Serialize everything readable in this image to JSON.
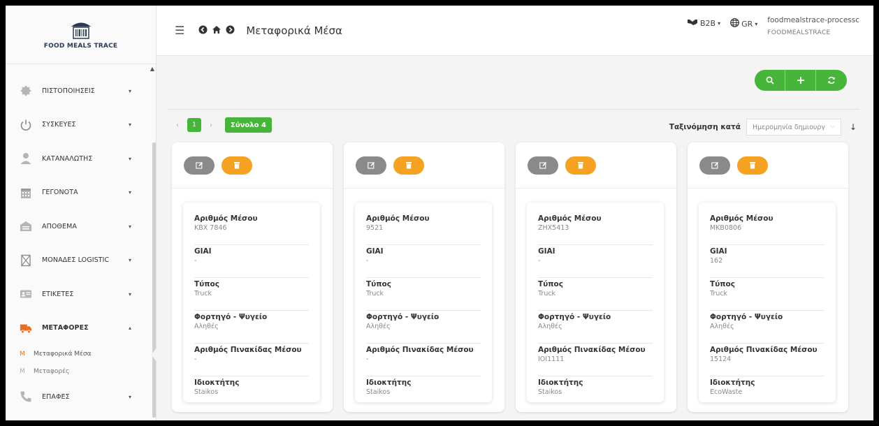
{
  "logo": {
    "text": "FOOD MEALS TRACE"
  },
  "sidebar": {
    "items": [
      {
        "label": "ΠΙΣΤΟΠΟΙΗΣΕΙΣ",
        "icon": "certificate-icon"
      },
      {
        "label": "ΣΥΣΚΕΥΕΣ",
        "icon": "power-icon"
      },
      {
        "label": "ΚΑΤΑΝΑΛΩΤΗΣ",
        "icon": "user-icon"
      },
      {
        "label": "ΓΕΓΟΝΟΤΑ",
        "icon": "calendar-icon"
      },
      {
        "label": "ΑΠΟΘΕΜΑ",
        "icon": "warehouse-icon"
      },
      {
        "label": "ΜΟΝΑΔΕΣ LOGISTIC",
        "icon": "box-icon"
      },
      {
        "label": "ΕΤΙΚΕΤΕΣ",
        "icon": "id-card-icon"
      },
      {
        "label": "ΜΕΤΑΦΟΡΕΣ",
        "icon": "truck-icon"
      },
      {
        "label": "ΕΠΑΦΕΣ",
        "icon": "phone-icon"
      }
    ],
    "subitems": [
      {
        "prefix": "M",
        "label": "Μεταφορικά Μέσα"
      },
      {
        "prefix": "M",
        "label": "Μεταφορές"
      }
    ]
  },
  "header": {
    "title": "Μεταφορικά Μέσα",
    "b2b": "B2B",
    "lang": "GR",
    "user": "foodmealstrace-processc",
    "org": "FOODMEALSTRACE"
  },
  "pager": {
    "page": "1",
    "total": "Σύνολο 4"
  },
  "sort": {
    "label": "Ταξινόμηση κατά",
    "value": "Ημερομηνία δημιουργ"
  },
  "cards": [
    {
      "fields": [
        {
          "label": "Αριθμός Μέσου",
          "value": "KBX 7846"
        },
        {
          "label": "GIAI",
          "value": "-"
        },
        {
          "label": "Τύπος",
          "value": "Truck"
        },
        {
          "label": "Φορτηγό - Ψυγείο",
          "value": "Αληθές"
        },
        {
          "label": "Αριθμός Πινακίδας Μέσου",
          "value": "-"
        },
        {
          "label": "Ιδιοκτήτης",
          "value": "Staikos"
        }
      ]
    },
    {
      "fields": [
        {
          "label": "Αριθμός Μέσου",
          "value": "9521"
        },
        {
          "label": "GIAI",
          "value": "-"
        },
        {
          "label": "Τύπος",
          "value": "Truck"
        },
        {
          "label": "Φορτηγό - Ψυγείο",
          "value": "Αληθές"
        },
        {
          "label": "Αριθμός Πινακίδας Μέσου",
          "value": "-"
        },
        {
          "label": "Ιδιοκτήτης",
          "value": "Staikos"
        }
      ]
    },
    {
      "fields": [
        {
          "label": "Αριθμός Μέσου",
          "value": "ZHX5413"
        },
        {
          "label": "GIAI",
          "value": "-"
        },
        {
          "label": "Τύπος",
          "value": "Truck"
        },
        {
          "label": "Φορτηγό - Ψυγείο",
          "value": "Αληθές"
        },
        {
          "label": "Αριθμός Πινακίδας Μέσου",
          "value": "IOI1111"
        },
        {
          "label": "Ιδιοκτήτης",
          "value": "Staikos"
        }
      ]
    },
    {
      "fields": [
        {
          "label": "Αριθμός Μέσου",
          "value": "MKB0806"
        },
        {
          "label": "GIAI",
          "value": "162"
        },
        {
          "label": "Τύπος",
          "value": "Truck"
        },
        {
          "label": "Φορτηγό - Ψυγείο",
          "value": "Αληθές"
        },
        {
          "label": "Αριθμός Πινακίδας Μέσου",
          "value": "15124"
        },
        {
          "label": "Ιδιοκτήτης",
          "value": "EcoWaste"
        }
      ]
    }
  ],
  "colors": {
    "accent": "#47b43a",
    "delete": "#f5a121",
    "edit": "#8a8a8a",
    "active": "#e96e1e"
  }
}
